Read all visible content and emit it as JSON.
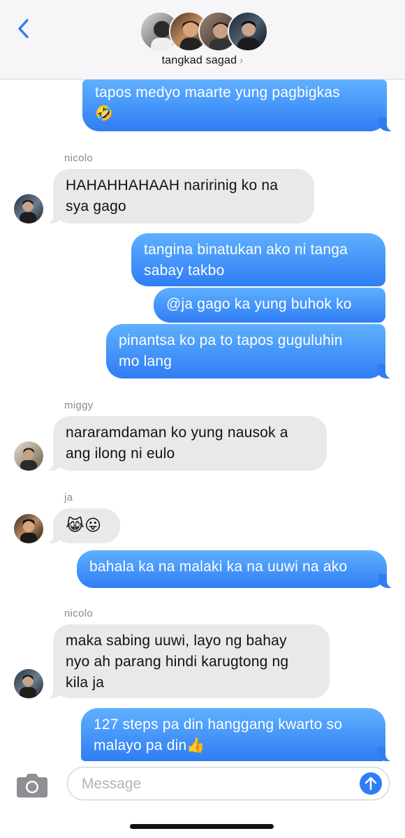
{
  "header": {
    "group_name": "tangkad sagad",
    "chevron": "›",
    "back_icon": "chevron-left-icon",
    "accent": "#2f7df4"
  },
  "messages": [
    {
      "dir": "out",
      "text": "tapos medyo maarte yung pagbigkas\n🤣"
    },
    {
      "sender": "nicolo",
      "dir": "in",
      "text": "HAHAHHAHAAH naririnig ko na\nsya gago"
    },
    {
      "dir": "out",
      "text": "tangina binatukan ako ni tanga\nsabay takbo"
    },
    {
      "dir": "out",
      "text": "@ja gago ka yung buhok ko"
    },
    {
      "dir": "out",
      "text": "pinantsa ko pa to tapos guguluhin\nmo lang"
    },
    {
      "sender": "miggy",
      "dir": "in",
      "text": "nararamdaman ko yung nausok a\nang ilong ni eulo"
    },
    {
      "sender": "ja",
      "dir": "in",
      "text": "😹😛"
    },
    {
      "dir": "out",
      "text": "bahala ka na malaki ka na uuwi na ako"
    },
    {
      "sender": "nicolo",
      "dir": "in",
      "text": "maka sabing uuwi, layo ng bahay\nnyo ah parang hindi karugtong ng\nkila ja"
    },
    {
      "dir": "out",
      "text": "127 steps pa din hanggang kwarto so\nmalayo pa din👍"
    }
  ],
  "composer": {
    "placeholder": "Message",
    "camera_icon": "camera-icon",
    "send_icon": "arrow-up-icon"
  }
}
